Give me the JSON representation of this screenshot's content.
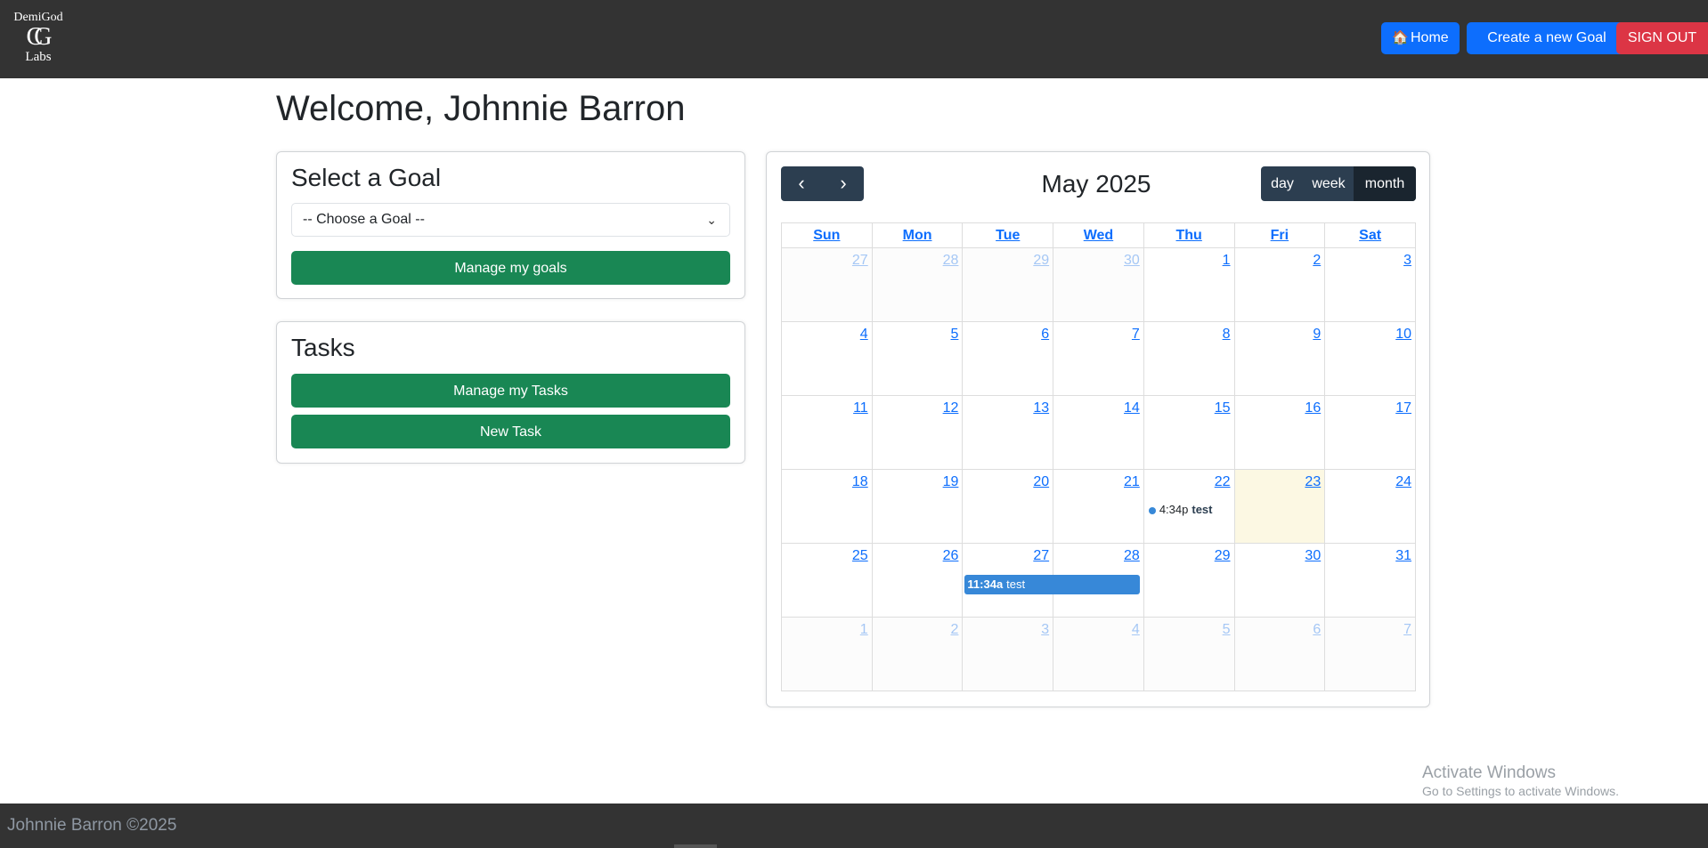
{
  "logo": {
    "line1": "DemiGod",
    "mark": "CG",
    "line3": "Labs"
  },
  "navbar": {
    "home_label": "Home",
    "home_icon": "house-icon",
    "new_goal_label": "Create a new Goal",
    "signout_label": "SIGN OUT"
  },
  "colors": {
    "navbar": "#333333",
    "primary": "#0d6efd",
    "danger": "#dc3545",
    "success": "#198754",
    "calendar_toolbar": "#2c3e50",
    "event": "#3788d8",
    "today": "#fcf8e3"
  },
  "welcome": "Welcome, Johnnie Barron",
  "goal_card": {
    "title": "Select a Goal",
    "select_value": "-- Choose a Goal --",
    "manage_label": "Manage my goals"
  },
  "tasks_card": {
    "title": "Tasks",
    "manage_label": "Manage my Tasks",
    "new_label": "New Task"
  },
  "calendar": {
    "title": "May 2025",
    "prev_icon": "chevron-left-icon",
    "next_icon": "chevron-right-icon",
    "views": [
      "day",
      "week",
      "month"
    ],
    "active_view": "month",
    "weekdays": [
      "Sun",
      "Mon",
      "Tue",
      "Wed",
      "Thu",
      "Fri",
      "Sat"
    ],
    "weeks": [
      [
        "27",
        "28",
        "29",
        "30",
        "1",
        "2",
        "3"
      ],
      [
        "4",
        "5",
        "6",
        "7",
        "8",
        "9",
        "10"
      ],
      [
        "11",
        "12",
        "13",
        "14",
        "15",
        "16",
        "17"
      ],
      [
        "18",
        "19",
        "20",
        "21",
        "22",
        "23",
        "24"
      ],
      [
        "25",
        "26",
        "27",
        "28",
        "29",
        "30",
        "31"
      ],
      [
        "1",
        "2",
        "3",
        "4",
        "5",
        "6",
        "7"
      ]
    ],
    "today": "23",
    "events": [
      {
        "date": "22",
        "time": "4:34p",
        "title": "test"
      },
      {
        "date": "27-28",
        "time": "11:34a",
        "title": "test"
      }
    ]
  },
  "watermark": {
    "line1": "Activate Windows",
    "line2": "Go to Settings to activate Windows."
  },
  "footer": "Johnnie Barron ©2025"
}
